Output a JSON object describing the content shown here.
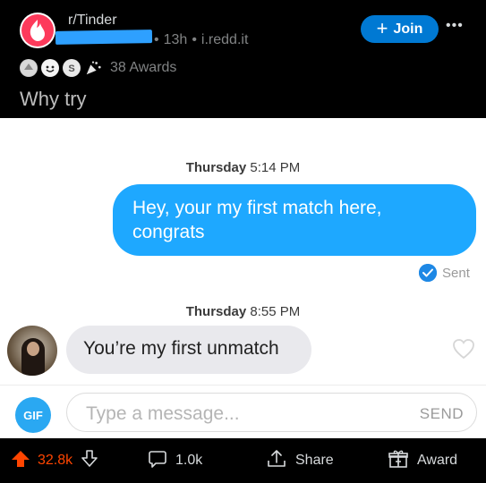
{
  "post": {
    "subreddit": "r/Tinder",
    "time": "13h",
    "separator": "•",
    "domain": "i.redd.it",
    "join_label": "Join",
    "more_label": "•••",
    "awards_label": "38 Awards",
    "title": "Why try"
  },
  "chat": {
    "messages": [
      {
        "day": "Thursday",
        "time": "5:14 PM",
        "text": "Hey, your my first match here, congrats",
        "direction": "sent",
        "status": "Sent"
      },
      {
        "day": "Thursday",
        "time": "8:55 PM",
        "text": "You’re my first unmatch",
        "direction": "received"
      }
    ],
    "composer": {
      "gif_label": "GIF",
      "placeholder": "Type a message...",
      "send_label": "SEND"
    }
  },
  "actions": {
    "upvotes": "32.8k",
    "comments": "1.0k",
    "share_label": "Share",
    "award_label": "Award"
  },
  "colors": {
    "reddit_blue": "#0079d3",
    "upvote_orange": "#ff4500",
    "tinder_sent_bubble": "#1ea8ff",
    "tinder_gif": "#2aa8f2",
    "tinder_logo": "#fd3a5b"
  }
}
